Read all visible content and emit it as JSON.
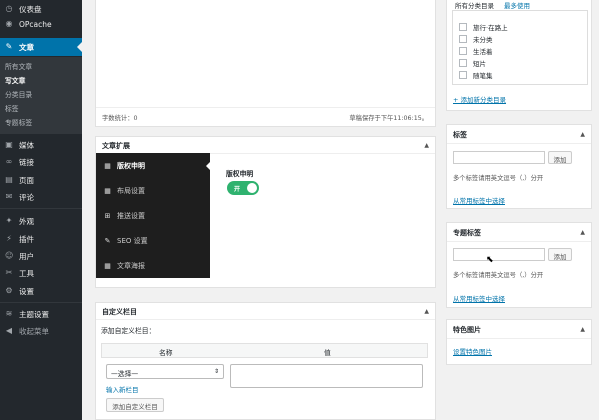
{
  "sidebar": {
    "items": [
      {
        "label": "仪表盘",
        "icon": "dashboard-icon",
        "glyph": "◷"
      },
      {
        "label": "OPcache",
        "icon": "opcache-icon",
        "glyph": "◉"
      },
      {
        "label": "文章",
        "icon": "pin-icon",
        "glyph": "✎"
      },
      {
        "label": "媒体",
        "icon": "media-icon",
        "glyph": "▣"
      },
      {
        "label": "链接",
        "icon": "link-icon",
        "glyph": "∞"
      },
      {
        "label": "页面",
        "icon": "page-icon",
        "glyph": "▤"
      },
      {
        "label": "评论",
        "icon": "comment-icon",
        "glyph": "✉"
      },
      {
        "label": "外观",
        "icon": "appearance-icon",
        "glyph": "✦"
      },
      {
        "label": "插件",
        "icon": "plugin-icon",
        "glyph": "⚡"
      },
      {
        "label": "用户",
        "icon": "user-icon",
        "glyph": "☺"
      },
      {
        "label": "工具",
        "icon": "tools-icon",
        "glyph": "✂"
      },
      {
        "label": "设置",
        "icon": "settings-icon",
        "glyph": "⚙"
      },
      {
        "label": "主题设置",
        "icon": "theme-settings-icon",
        "glyph": "≋"
      },
      {
        "label": "收起菜单",
        "icon": "collapse-icon",
        "glyph": "◀"
      }
    ],
    "submenu": [
      "所有文章",
      "写文章",
      "分类目录",
      "标签",
      "专题标签"
    ]
  },
  "editor": {
    "word_count": "字数统计：0",
    "draft_saved": "草稿保存于下午11:06:15。"
  },
  "extension": {
    "title": "文章扩展",
    "tabs": [
      {
        "label": "版权申明",
        "glyph": "▦"
      },
      {
        "label": "布局设置",
        "glyph": "▦"
      },
      {
        "label": "推送设置",
        "glyph": "⊞"
      },
      {
        "label": "SEO 设置",
        "glyph": "✎"
      },
      {
        "label": "文章海报",
        "glyph": "▦"
      }
    ],
    "field_label": "版权申明",
    "toggle_label": "开"
  },
  "custom_fields": {
    "title": "自定义栏目",
    "add_label": "添加自定义栏目：",
    "col_name": "名称",
    "col_value": "值",
    "select_value": "—选择—",
    "enter_new_link": "输入新栏目",
    "add_button": "添加自定义栏目"
  },
  "categories": {
    "tab_all": "所有分类目录",
    "tab_popular": "最多使用",
    "items": [
      "旅行·在路上",
      "未分类",
      "生活着",
      "短片",
      "随笔集"
    ],
    "add_new": "+ 添加新分类目录"
  },
  "tags": {
    "title": "标签",
    "add_button": "添加",
    "hint": "多个标签请用英文逗号（,）分开",
    "choose_link": "从常用标签中选择"
  },
  "topic_tags": {
    "title": "专题标签",
    "add_button": "添加",
    "hint": "多个标签请用英文逗号（,）分开",
    "choose_link": "从常用标签中选择"
  },
  "featured_image": {
    "title": "特色图片",
    "set_link": "设置特色图片"
  },
  "colors": {
    "sidebar_bg": "#23282d",
    "accent": "#0073aa",
    "toggle_on": "#2fb26f"
  }
}
